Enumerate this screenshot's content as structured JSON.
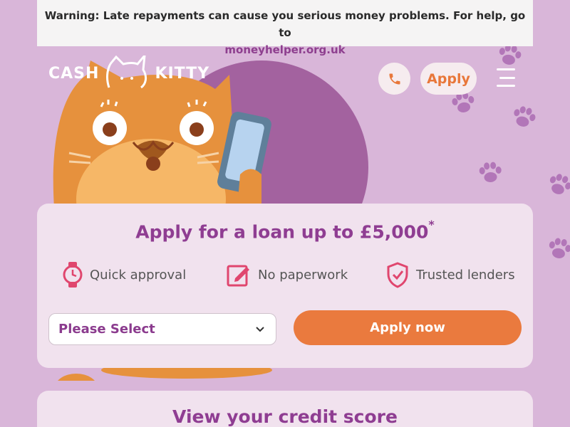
{
  "warning": {
    "text": "Warning: Late repayments can cause you serious money problems. For help, go to",
    "link": "moneyhelper.org.uk"
  },
  "header": {
    "logo_left": "CASH",
    "logo_right": "KITTY",
    "apply_label": "Apply"
  },
  "loan_card": {
    "title": "Apply for a loan up to £5,000",
    "title_mark": "*",
    "features": [
      {
        "label": "Quick approval",
        "icon": "watch-icon"
      },
      {
        "label": "No paperwork",
        "icon": "edit-icon"
      },
      {
        "label": "Trusted lenders",
        "icon": "shield-check-icon"
      }
    ],
    "select_value": "Please Select",
    "apply_now_label": "Apply now"
  },
  "credit_card": {
    "title": "View your credit score"
  },
  "colors": {
    "background": "#d9b6d9",
    "brand_purple": "#8f3d92",
    "accent_orange": "#ea7a3e",
    "icon_pink": "#e0466e"
  }
}
